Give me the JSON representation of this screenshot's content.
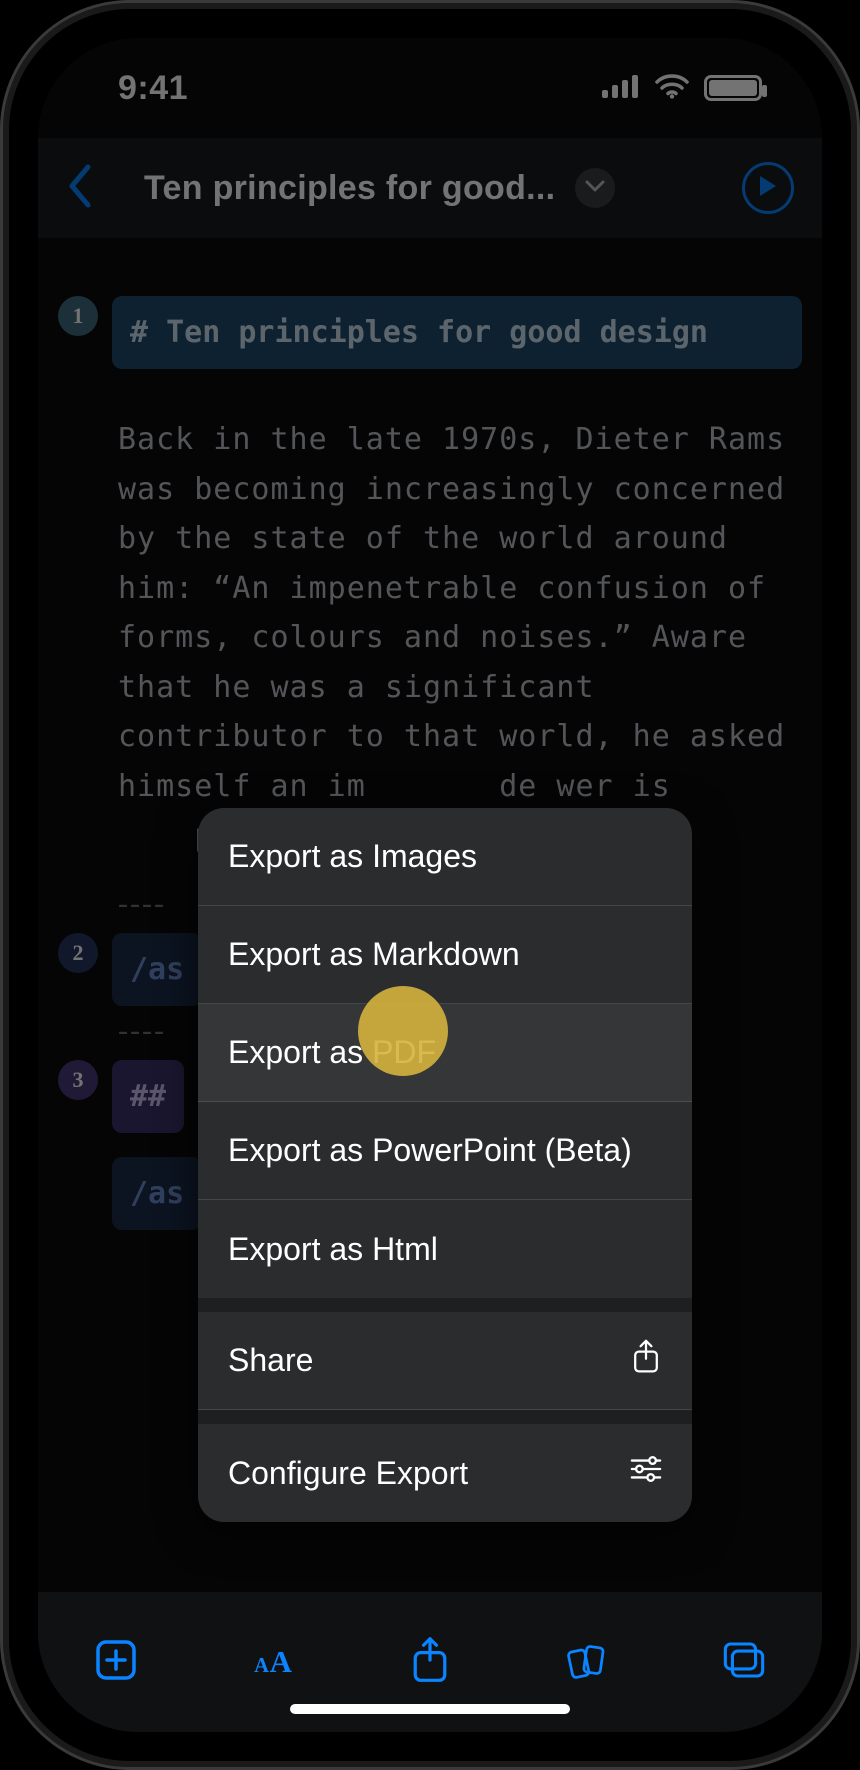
{
  "status": {
    "time": "9:41"
  },
  "nav": {
    "title": "Ten principles for good..."
  },
  "editor": {
    "heading": "# Ten principles for good design",
    "paragraph": "Back in the late 1970s, Dieter Rams was becoming increasingly concerned by the state of the world around him: “An impenetrable confusion of forms, colours and noises.” Aware that he was a significant contributor to that world, he asked himself an im                                  de                             wer is                                 pr",
    "dashes": "----",
    "asset_prefix": "/as",
    "h2_prefix": "##",
    "asset2_prefix": "/as",
    "line2": "2",
    "line3": "3",
    "line1": "1"
  },
  "menu": {
    "items": [
      "Export as Images",
      "Export as Markdown",
      "Export as PDF",
      "Export as PowerPoint (Beta)",
      "Export as Html"
    ],
    "share": "Share",
    "configure": "Configure Export"
  }
}
